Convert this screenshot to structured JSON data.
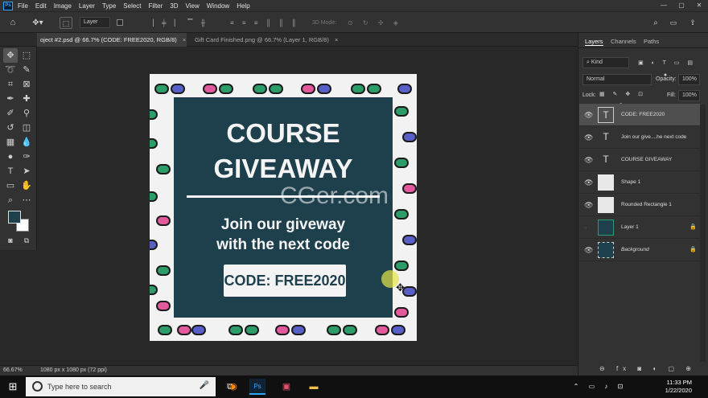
{
  "menu": {
    "app_icon": "Ps",
    "items": [
      "File",
      "Edit",
      "Image",
      "Layer",
      "Type",
      "Select",
      "Filter",
      "3D",
      "View",
      "Window",
      "Help"
    ],
    "window_controls": [
      "—",
      "▢",
      "✕"
    ]
  },
  "options_bar": {
    "auto_select_value": "Layer",
    "mode_3d_label": "3D Mode:"
  },
  "tabs": [
    {
      "label": "oject #2.psd @ 66.7% (CODE: FREE2020, RGB/8)",
      "close": "×"
    },
    {
      "label": "Gift Card Finished.png @ 66.7% (Layer 1, RGB/8)",
      "close": "×"
    }
  ],
  "document": {
    "title_line1": "COURSE",
    "title_line2": "GIVEAWAY",
    "body_line1": "Join our giveway",
    "body_line2": "with the next code",
    "code": "CODE: FREE2020",
    "watermark": "CGer.com",
    "colors": {
      "panel": "#1e3f4c",
      "pattern_bg": "#f2f2f2",
      "pill_green": "#2c9c68",
      "pill_pink": "#e35a9c",
      "pill_blue": "#5860c8"
    }
  },
  "panels": {
    "tabs": [
      "Layers",
      "Channels",
      "Paths"
    ],
    "kind_filter": "Kind",
    "blend_mode": "Normal",
    "opacity_label": "Opacity:",
    "opacity_value": "100%",
    "lock_label": "Lock:",
    "fill_label": "Fill:",
    "fill_value": "100%",
    "layers": [
      {
        "name": "CODE: FREE2020",
        "type": "text",
        "selected": true
      },
      {
        "name": "Join our give....he next code",
        "type": "text",
        "selected": false
      },
      {
        "name": "COURSE   GIVEAWAY",
        "type": "text",
        "selected": false
      },
      {
        "name": "Shape 1",
        "type": "shape",
        "selected": false
      },
      {
        "name": "Rounded Rectangle 1",
        "type": "shape",
        "selected": false
      },
      {
        "name": "Layer 1",
        "type": "image",
        "selected": false,
        "locked": true
      },
      {
        "name": "Background",
        "type": "image",
        "selected": false,
        "locked": true
      }
    ]
  },
  "status_bar": {
    "zoom": "66.67%",
    "doc_size": "1080 px x 1080 px (72 ppi)"
  },
  "taskbar": {
    "search_placeholder": "Type here to search",
    "time": "11:33 PM",
    "date": "1/22/2020"
  }
}
